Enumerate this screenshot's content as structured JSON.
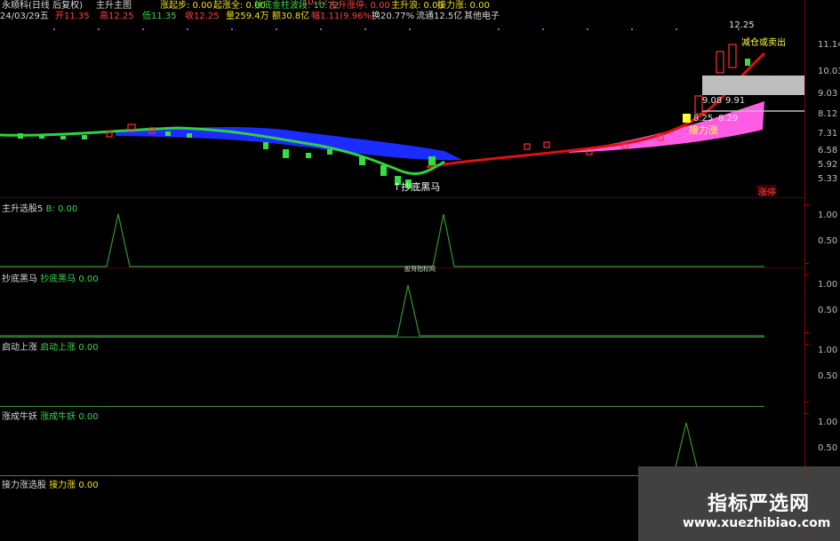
{
  "header": {
    "stock_name": "永顺科(日线 后复权)",
    "indicator_name": "主升主图",
    "date": "24/03/29五",
    "open_label": "开11.35",
    "high_label": "高12.25",
    "low_label": "低11.35",
    "close_label": "收12.25",
    "volume_label": "量259.4万",
    "amount_label": "额30.8亿",
    "change_label": "幅1.11(9.96%)",
    "turnover_label": "换20.77%",
    "float_label": "流通12.5亿",
    "sector_label": "其他电子",
    "top_items": [
      "涨起步: 0.00",
      "起涨全: 0.00",
      "抄底金柱波段: 10.72",
      "10.72",
      "主升涨停: 0.00",
      "主升浪: 0.00",
      "接力涨: 0.00"
    ]
  },
  "main_chart": {
    "price_scale": [
      "11.14",
      "10.03",
      "9.03",
      "8.12",
      "7.31",
      "6.58",
      "5.92",
      "5.33"
    ],
    "annotations": {
      "high_price": "12.25",
      "sell_signal": "减仓或卖出",
      "zone_a": "9.08",
      "zone_b": "9.91",
      "zone_c": "8.25",
      "zone_d": "8.29",
      "relay": "接力涨",
      "bottom_horse": "↑抄底黑马",
      "limit_up": "涨停"
    },
    "colors": {
      "up": "#ff3030",
      "down": "#30e040",
      "blue_band": "#1a2cff",
      "pink_band": "#ff5ce6"
    }
  },
  "panes": [
    {
      "name": "主升选股5",
      "title_a": "主升选股5",
      "value_a": "B: 0.00",
      "value_b": "",
      "scale": [
        "1.00",
        "0.50"
      ],
      "note": ""
    },
    {
      "name": "抄底黑马",
      "title_a": "抄底黑马",
      "value_a": "抄底黑马",
      "value_b": "0.00",
      "scale": [
        "1.00",
        "0.50"
      ],
      "note": ""
    },
    {
      "name": "启动上涨",
      "title_a": "启动上涨",
      "value_a": "启动上涨",
      "value_b": "0.00",
      "scale": [
        "1.00",
        "0.50"
      ],
      "note": ""
    },
    {
      "name": "涨成牛妖",
      "title_a": "涨成牛妖",
      "value_a": "涨成牛妖",
      "value_b": "0.00",
      "scale": [
        "1.00",
        "0.50"
      ],
      "note": ""
    },
    {
      "name": "接力涨选股",
      "title_a": "接力涨选股",
      "value_a": "接力涨",
      "value_b": "0.00",
      "scale": [],
      "note": ""
    }
  ],
  "mid_label": "股哥指标网",
  "watermark": {
    "title": "指标严选网",
    "url": "www.xuezhibiao.com"
  }
}
